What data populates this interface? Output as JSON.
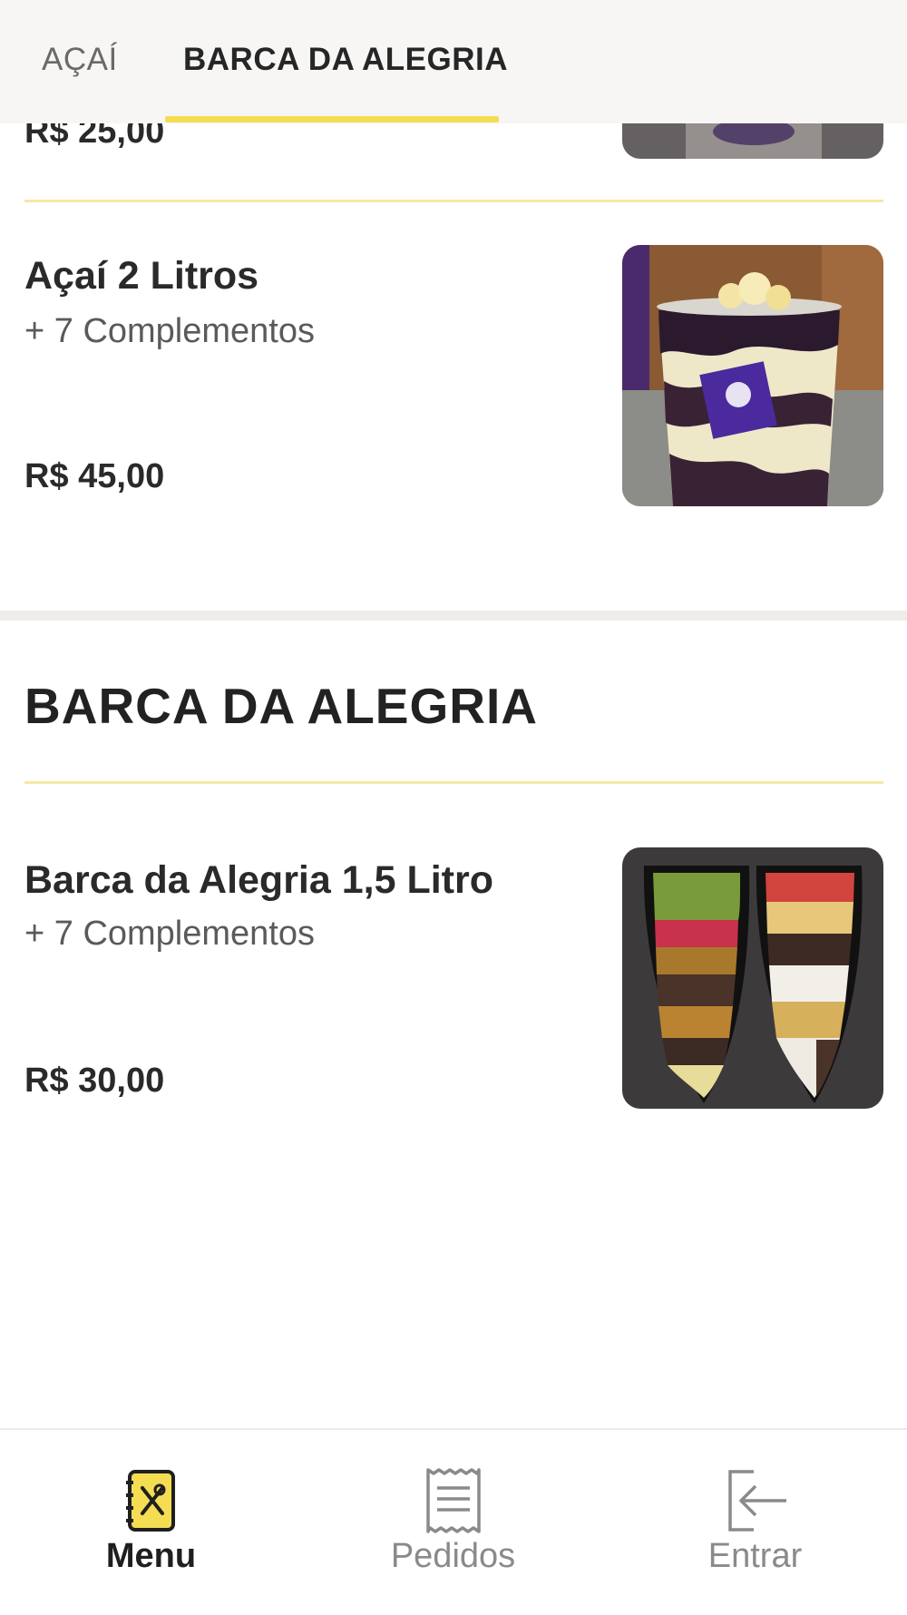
{
  "tabs": [
    {
      "label": "AÇAÍ",
      "active": false
    },
    {
      "label": "BARCA DA ALEGRIA",
      "active": true
    }
  ],
  "partial_item": {
    "price": "R$ 25,00"
  },
  "items_acai": [
    {
      "name": "Açaí 2 Litros",
      "complements": "+ 7 Complementos",
      "price": "R$ 45,00",
      "image": "acai-cup-photo"
    }
  ],
  "section": {
    "title": "BARCA DA ALEGRIA"
  },
  "items_barca": [
    {
      "name": "Barca da Alegria 1,5 Litro",
      "complements": "+ 7 Complementos",
      "price": "R$ 30,00",
      "image": "acai-boat-photo"
    }
  ],
  "bottom_nav": [
    {
      "label": "Menu",
      "icon": "menu-book-icon",
      "active": true
    },
    {
      "label": "Pedidos",
      "icon": "receipt-icon",
      "active": false
    },
    {
      "label": "Entrar",
      "icon": "login-arrow-icon",
      "active": false
    }
  ],
  "colors": {
    "accent": "#f4dd52",
    "divider": "#f6e9a3",
    "text": "#262626",
    "muted": "#8a8a8a"
  }
}
